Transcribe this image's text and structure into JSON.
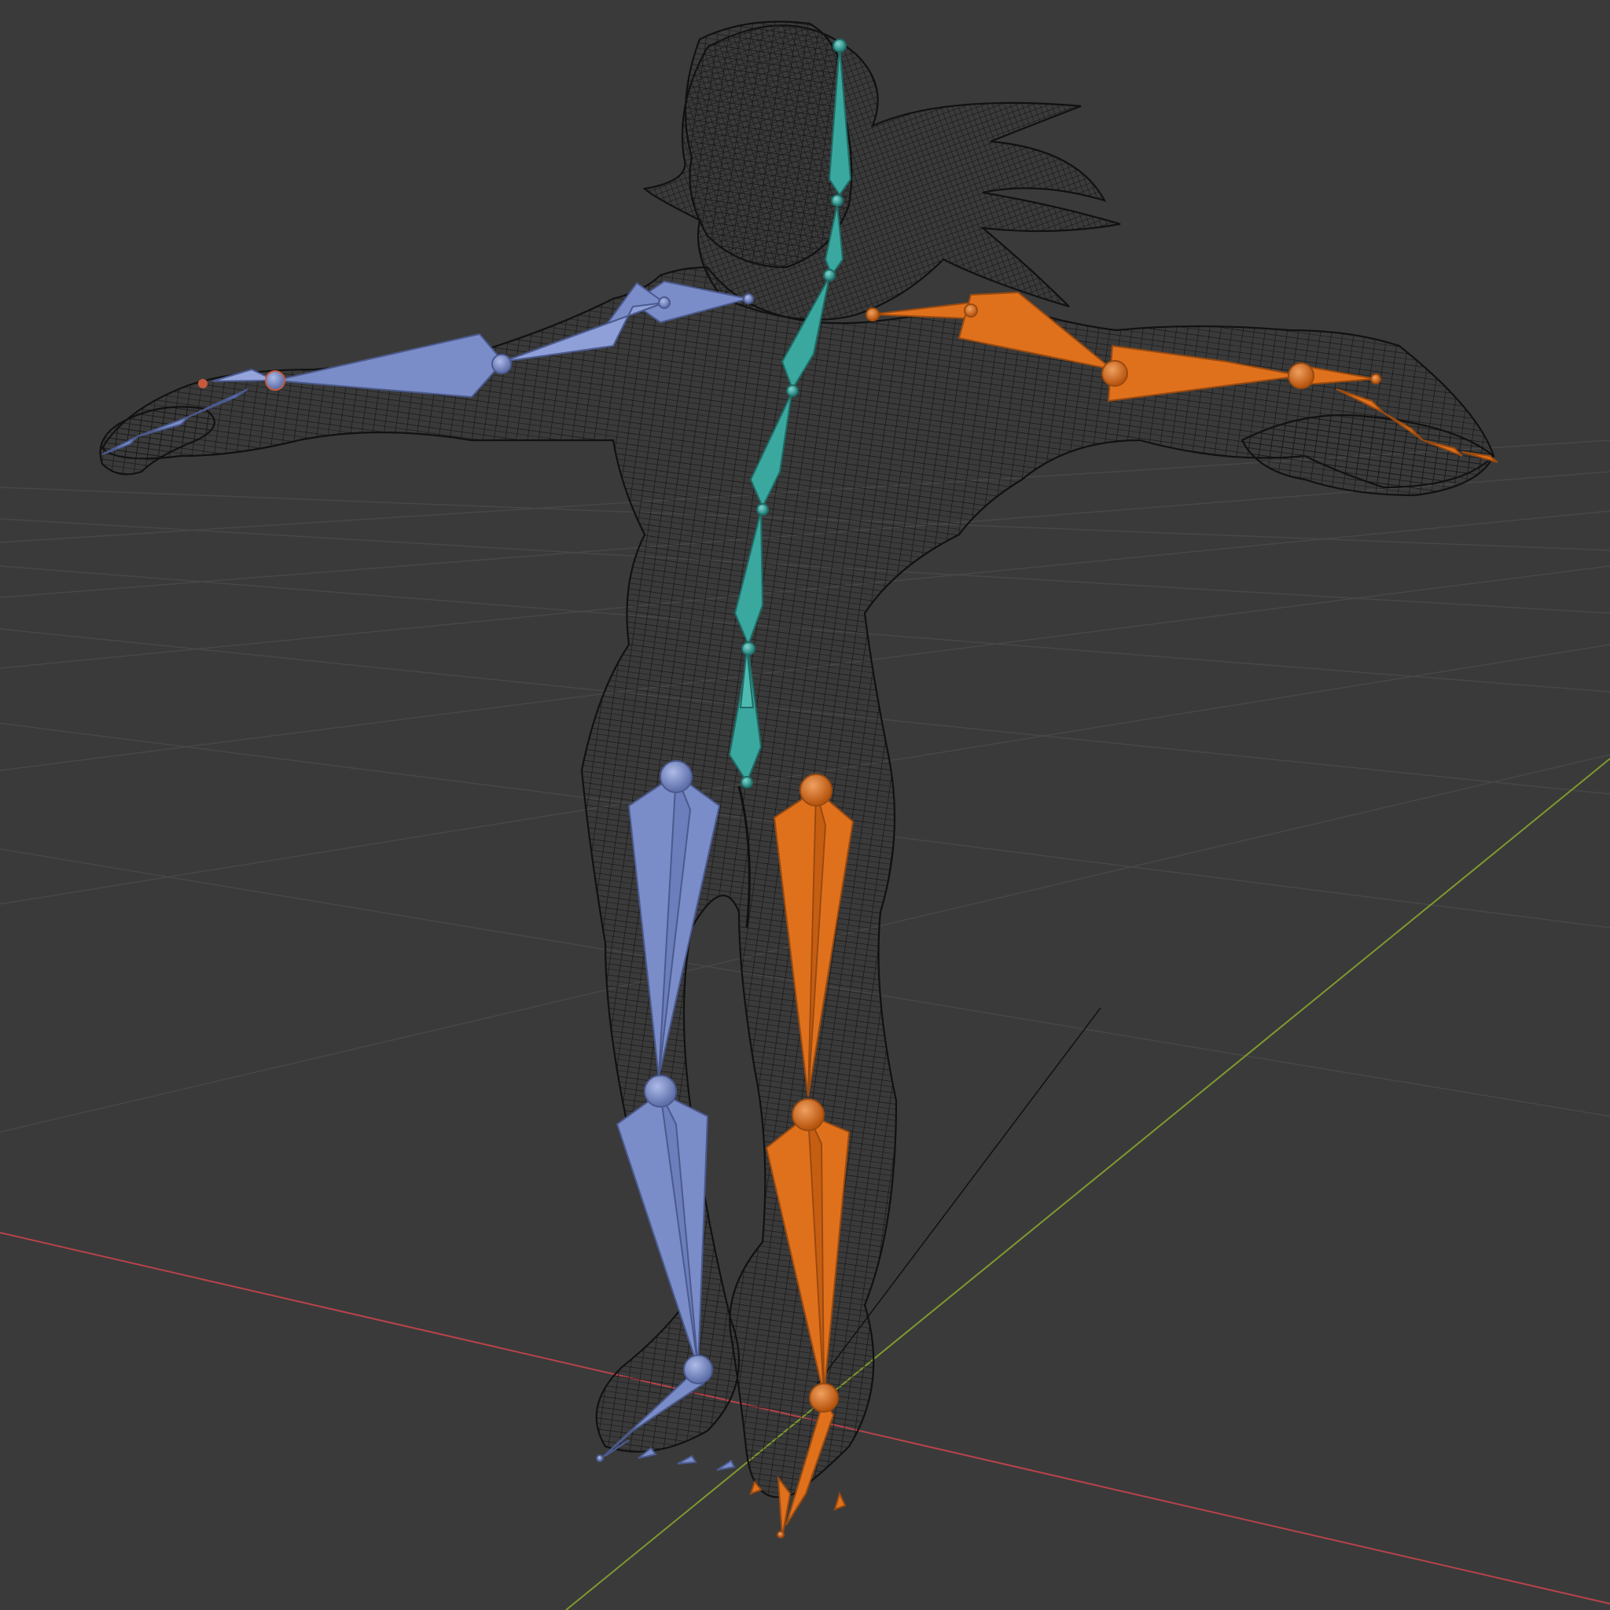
{
  "viewport": {
    "mode": "3d-wireframe",
    "background_color": "#3a3a3a",
    "grid_color": "#4a4a4a",
    "x_axis_color": "#b8434a",
    "y_axis_color": "#7e9a2e"
  },
  "mesh": {
    "object": "humanoid-character",
    "display": "wireframe",
    "wire_color": "#111111"
  },
  "armature": {
    "display": "octahedral",
    "colors": {
      "center": "#3aa89f",
      "left": "#7b8dc8",
      "right": "#e0711c"
    },
    "bone_groups": [
      "spine-head",
      "left-arm",
      "right-arm",
      "left-leg",
      "right-leg",
      "left-foot-toes",
      "right-foot-toes",
      "left-fingers",
      "right-fingers"
    ]
  }
}
